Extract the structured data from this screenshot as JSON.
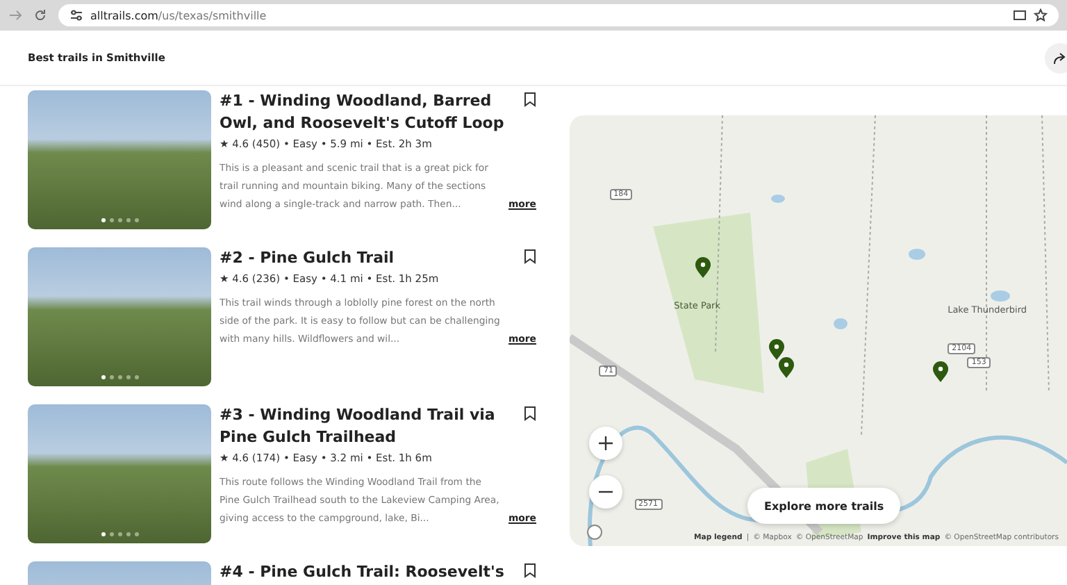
{
  "browser": {
    "url_host": "alltrails.com",
    "url_path": "/us/texas/smithville"
  },
  "header": {
    "title": "Best trails in Smithville"
  },
  "trails": [
    {
      "title": "#1 - Winding Woodland, Barred Owl, and Roosevelt's Cutoff Loop",
      "stats": "★ 4.6 (450) • Easy • 5.9 mi • Est. 2h 3m",
      "description": "This is a pleasant and scenic trail that is a great pick for trail running and mountain biking. Many of the sections wind along a single-track and narrow path. Then...",
      "more": "more",
      "saved": false,
      "slides": [
        {
          "selected": true
        },
        {
          "selected": false
        },
        {
          "selected": false
        },
        {
          "selected": false
        },
        {
          "selected": false
        }
      ]
    },
    {
      "title": "#2 - Pine Gulch Trail",
      "stats": "★ 4.6 (236) • Easy • 4.1 mi • Est. 1h 25m",
      "description": "This trail winds through a loblolly pine forest on the north side of the park. It is easy to follow but can be challenging with many hills. Wildflowers and wil...",
      "more": "more",
      "saved": false,
      "slides": [
        {
          "selected": true
        },
        {
          "selected": false
        },
        {
          "selected": false
        },
        {
          "selected": false
        },
        {
          "selected": false
        }
      ]
    },
    {
      "title": "#3 - Winding Woodland Trail via Pine Gulch Trailhead",
      "stats": "★ 4.6 (174) • Easy • 3.2 mi • Est. 1h 6m",
      "description": "This route follows the Winding Woodland Trail from the Pine Gulch Trailhead south to the Lakeview Camping Area, giving access to the campground, lake, Bi...",
      "more": "more",
      "saved": false,
      "slides": [
        {
          "selected": true
        },
        {
          "selected": false
        },
        {
          "selected": false
        },
        {
          "selected": false
        },
        {
          "selected": false
        }
      ]
    },
    {
      "title": "#4 - Pine Gulch Trail: Roosevelt's",
      "saved": false
    }
  ],
  "map": {
    "labels": [
      {
        "text": "State Park",
        "kind": "park"
      },
      {
        "text": "Lake Thunderbird",
        "kind": "place"
      },
      {
        "text": "184",
        "kind": "shield"
      },
      {
        "text": "71",
        "kind": "shield"
      },
      {
        "text": "2104",
        "kind": "shield"
      },
      {
        "text": "153",
        "kind": "shield"
      },
      {
        "text": "2571",
        "kind": "shield"
      }
    ],
    "explore_button": "Explore more trails",
    "attribution": {
      "legend": "Map legend",
      "separator": "|",
      "mapbox": "© Mapbox",
      "osm": "© OpenStreetMap",
      "improve": "Improve this map",
      "contributors": "© OpenStreetMap contributors"
    }
  }
}
